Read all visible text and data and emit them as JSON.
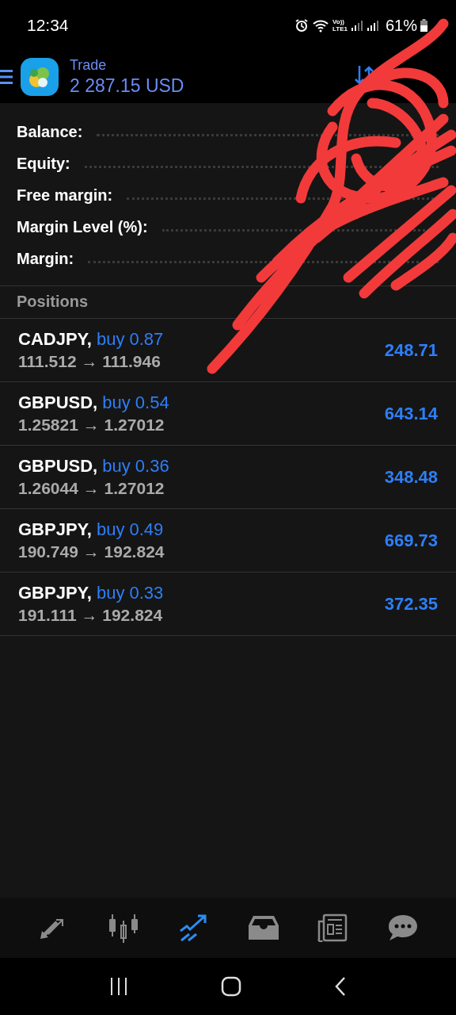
{
  "status_bar": {
    "time": "12:34",
    "volte": "Vo))",
    "network": "LTE1",
    "battery": "61%"
  },
  "header": {
    "title": "Trade",
    "balance": "2 287.15 USD"
  },
  "summary": [
    {
      "label": "Balance:"
    },
    {
      "label": "Equity:"
    },
    {
      "label": "Free margin:"
    },
    {
      "label": "Margin Level (%):"
    },
    {
      "label": "Margin:"
    }
  ],
  "positions": {
    "title": "Positions",
    "items": [
      {
        "symbol": "CADJPY,",
        "order": "buy 0.87",
        "prices": "111.512 → 111.946",
        "profit": "248.71"
      },
      {
        "symbol": "GBPUSD,",
        "order": "buy 0.54",
        "prices": "1.25821 → 1.27012",
        "profit": "643.14"
      },
      {
        "symbol": "GBPUSD,",
        "order": "buy 0.36",
        "prices": "1.26044 → 1.27012",
        "profit": "348.48"
      },
      {
        "symbol": "GBPJPY,",
        "order": "buy 0.49",
        "prices": "190.749 → 192.824",
        "profit": "669.73"
      },
      {
        "symbol": "GBPJPY,",
        "order": "buy 0.33",
        "prices": "191.111 → 192.824",
        "profit": "372.35"
      }
    ]
  },
  "bottom_nav": [
    {
      "kind": "quotes",
      "selected": false
    },
    {
      "kind": "chart",
      "selected": false
    },
    {
      "kind": "trade",
      "selected": true
    },
    {
      "kind": "history",
      "selected": false
    },
    {
      "kind": "news",
      "selected": false
    },
    {
      "kind": "chat",
      "selected": false
    }
  ]
}
